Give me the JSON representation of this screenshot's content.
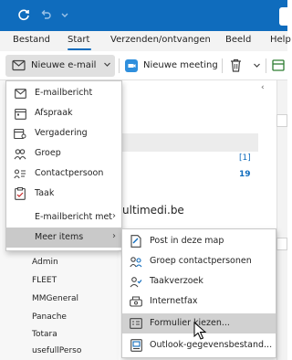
{
  "titlebar": {
    "icons": [
      "sync-icon",
      "undo-icon",
      "dropdown-icon"
    ],
    "colors": {
      "background": "#0f6cbd"
    }
  },
  "ribbon": {
    "tabs": [
      {
        "label": "Bestand"
      },
      {
        "label": "Start"
      },
      {
        "label": "Verzenden/ontvangen"
      },
      {
        "label": "Beeld"
      },
      {
        "label": "Help"
      }
    ],
    "active_tab": "Start",
    "commands": {
      "new_mail_label": "Nieuwe e-mail",
      "new_meeting_label": "Nieuwe meeting"
    }
  },
  "background": {
    "count_1": "[1]",
    "count_2": "19",
    "partial_text": "ultimedi.be",
    "folders": [
      "Admin",
      "FLEET",
      "MMGeneral",
      "Panache",
      "Totara",
      "usefullPerso"
    ]
  },
  "menu": {
    "items": [
      {
        "label": "E-mailbericht",
        "icon": "mail-icon"
      },
      {
        "label": "Afspraak",
        "icon": "calendar-icon"
      },
      {
        "label": "Vergadering",
        "icon": "meeting-icon"
      },
      {
        "label": "Groep",
        "icon": "group-icon"
      },
      {
        "label": "Contactpersoon",
        "icon": "contact-card-icon"
      },
      {
        "label": "Taak",
        "icon": "task-icon"
      },
      {
        "label": "E-mailbericht met",
        "icon": ""
      },
      {
        "label": "Meer items",
        "icon": ""
      }
    ],
    "highlighted": "Meer items"
  },
  "submenu": {
    "items": [
      {
        "label": "Post in deze map",
        "icon": "post-icon"
      },
      {
        "label": "Groep contactpersonen",
        "icon": "contact-group-icon"
      },
      {
        "label": "Taakverzoek",
        "icon": "task-request-icon"
      },
      {
        "label": "Internetfax",
        "icon": "fax-icon"
      },
      {
        "label": "Formulier kiezen...",
        "icon": "form-icon"
      },
      {
        "label": "Outlook-gegevensbestand...",
        "icon": "data-file-icon"
      }
    ],
    "highlighted": "Formulier kiezen..."
  }
}
